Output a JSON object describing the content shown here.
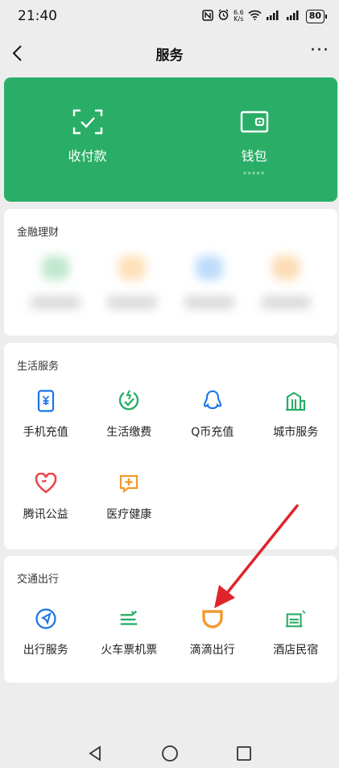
{
  "status_bar": {
    "time": "21:40",
    "net_speed_top": "6.6",
    "net_speed_bottom": "K/s",
    "battery": "80"
  },
  "navbar": {
    "title": "服务",
    "more": "···"
  },
  "wallet_card": {
    "items": [
      {
        "label": "收付款",
        "icon": "scan-pay-icon"
      },
      {
        "label": "钱包",
        "sub": "*****",
        "icon": "wallet-icon"
      }
    ]
  },
  "finance": {
    "title": "金融理财",
    "blurred_icon_colors": [
      "#bfe8cf",
      "#fde0b8",
      "#bcdcfb",
      "#fcdcb4"
    ]
  },
  "life_services": {
    "title": "生活服务",
    "items": [
      {
        "label": "手机充值",
        "icon": "phone-recharge-icon",
        "color": "#1a73e8"
      },
      {
        "label": "生活缴费",
        "icon": "utility-payment-icon",
        "color": "#2aae67"
      },
      {
        "label": "Q币充值",
        "icon": "qq-coin-icon",
        "color": "#1a73e8"
      },
      {
        "label": "城市服务",
        "icon": "city-service-icon",
        "color": "#2aae67"
      },
      {
        "label": "腾讯公益",
        "icon": "charity-heart-icon",
        "color": "#e8474c"
      },
      {
        "label": "医疗健康",
        "icon": "medical-icon",
        "color": "#f29a2e"
      }
    ]
  },
  "travel": {
    "title": "交通出行",
    "items": [
      {
        "label": "出行服务",
        "icon": "navigation-icon",
        "color": "#1a73e8"
      },
      {
        "label": "火车票机票",
        "icon": "train-ticket-icon",
        "color": "#2aae67"
      },
      {
        "label": "滴滴出行",
        "icon": "didi-icon",
        "color": "#f29a2e"
      },
      {
        "label": "酒店民宿",
        "icon": "hotel-icon",
        "color": "#2aae67"
      }
    ]
  },
  "annotation_color": "#e0242b"
}
